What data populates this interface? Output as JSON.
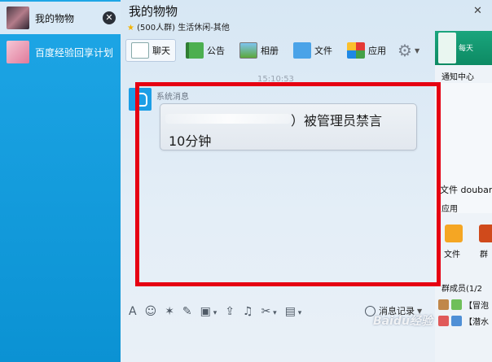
{
  "sidebar": {
    "conversations": [
      {
        "name": "我的物物",
        "active": true
      },
      {
        "name": "百度经验回享计划",
        "active": false
      }
    ],
    "close_glyph": "✕"
  },
  "window": {
    "title": "我的物物",
    "subtitle_count": "(500人群)",
    "subtitle_category": "生活休闲-其他",
    "close_glyph": "✕"
  },
  "tabs": [
    {
      "label": "聊天",
      "icon": "chat-icon",
      "selected": true
    },
    {
      "label": "公告",
      "icon": "flag-icon",
      "selected": false
    },
    {
      "label": "相册",
      "icon": "photo-icon",
      "selected": false
    },
    {
      "label": "文件",
      "icon": "folder-icon",
      "selected": false
    },
    {
      "label": "应用",
      "icon": "apps-icon",
      "selected": false
    }
  ],
  "chat": {
    "timestamp": "15:10:53",
    "sender": "系统消息",
    "message_line1": "）被管理员禁言",
    "message_line2": "10分钟"
  },
  "input_toolbar": {
    "history_label": "消息记录"
  },
  "right_panel": {
    "ad_text": "每天",
    "notify_title": "通知中心",
    "file_item": "文件 doubar",
    "apps_title": "应用",
    "apps": [
      "文件",
      "群"
    ],
    "members_title": "群成员(1/2",
    "members": [
      "【冒泡",
      "【潜水"
    ]
  },
  "watermark": "Baidu经验",
  "colors": {
    "accent_blue": "#0f8fcf",
    "highlight_red": "#e60012"
  }
}
